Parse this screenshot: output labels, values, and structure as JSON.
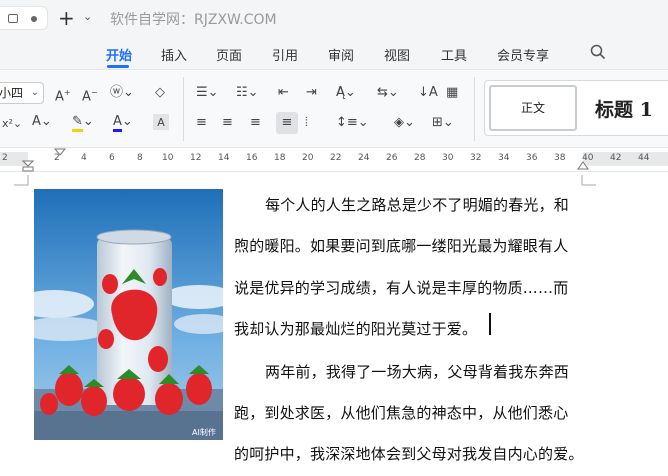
{
  "titlebar": {
    "site_text": "软件自学网：RJZXW.COM",
    "new_tab_symbol": "+",
    "dropdown_symbol": "⌄"
  },
  "menu": {
    "tabs": [
      "开始",
      "插入",
      "页面",
      "引用",
      "审阅",
      "视图",
      "工具",
      "会员专享"
    ],
    "active_index": 0
  },
  "ribbon": {
    "font_size_value": "小四",
    "style_normal_label": "正文",
    "style_heading_label": "标题 1"
  },
  "ruler": {
    "ticks": [
      "2",
      "2",
      "4",
      "6",
      "8",
      "10",
      "12",
      "14",
      "16",
      "18",
      "20",
      "22",
      "24",
      "26",
      "28",
      "30",
      "32",
      "34",
      "36",
      "38",
      "40",
      "42",
      "44"
    ]
  },
  "document": {
    "image_watermark": "AI制作",
    "lines": [
      "每个人的人生之路总是少不了明媚的春光，和",
      "煦的暖阳。如果要问到底哪一缕阳光最为耀眼有人",
      "说是优异的学习成绩，有人说是丰厚的物质……而",
      "我却认为那最灿烂的阳光莫过于爱。",
      "两年前，我得了一场大病，父母背着我东奔西",
      "跑，到处求医，从他们焦急的神态中，从他们悉心",
      "的呵护中，我深深地体会到父母对我发自内心的爱。"
    ]
  },
  "colors": {
    "accent": "#1e6fff",
    "highlight": "#f5d300",
    "font_color": "#1a1aff"
  }
}
